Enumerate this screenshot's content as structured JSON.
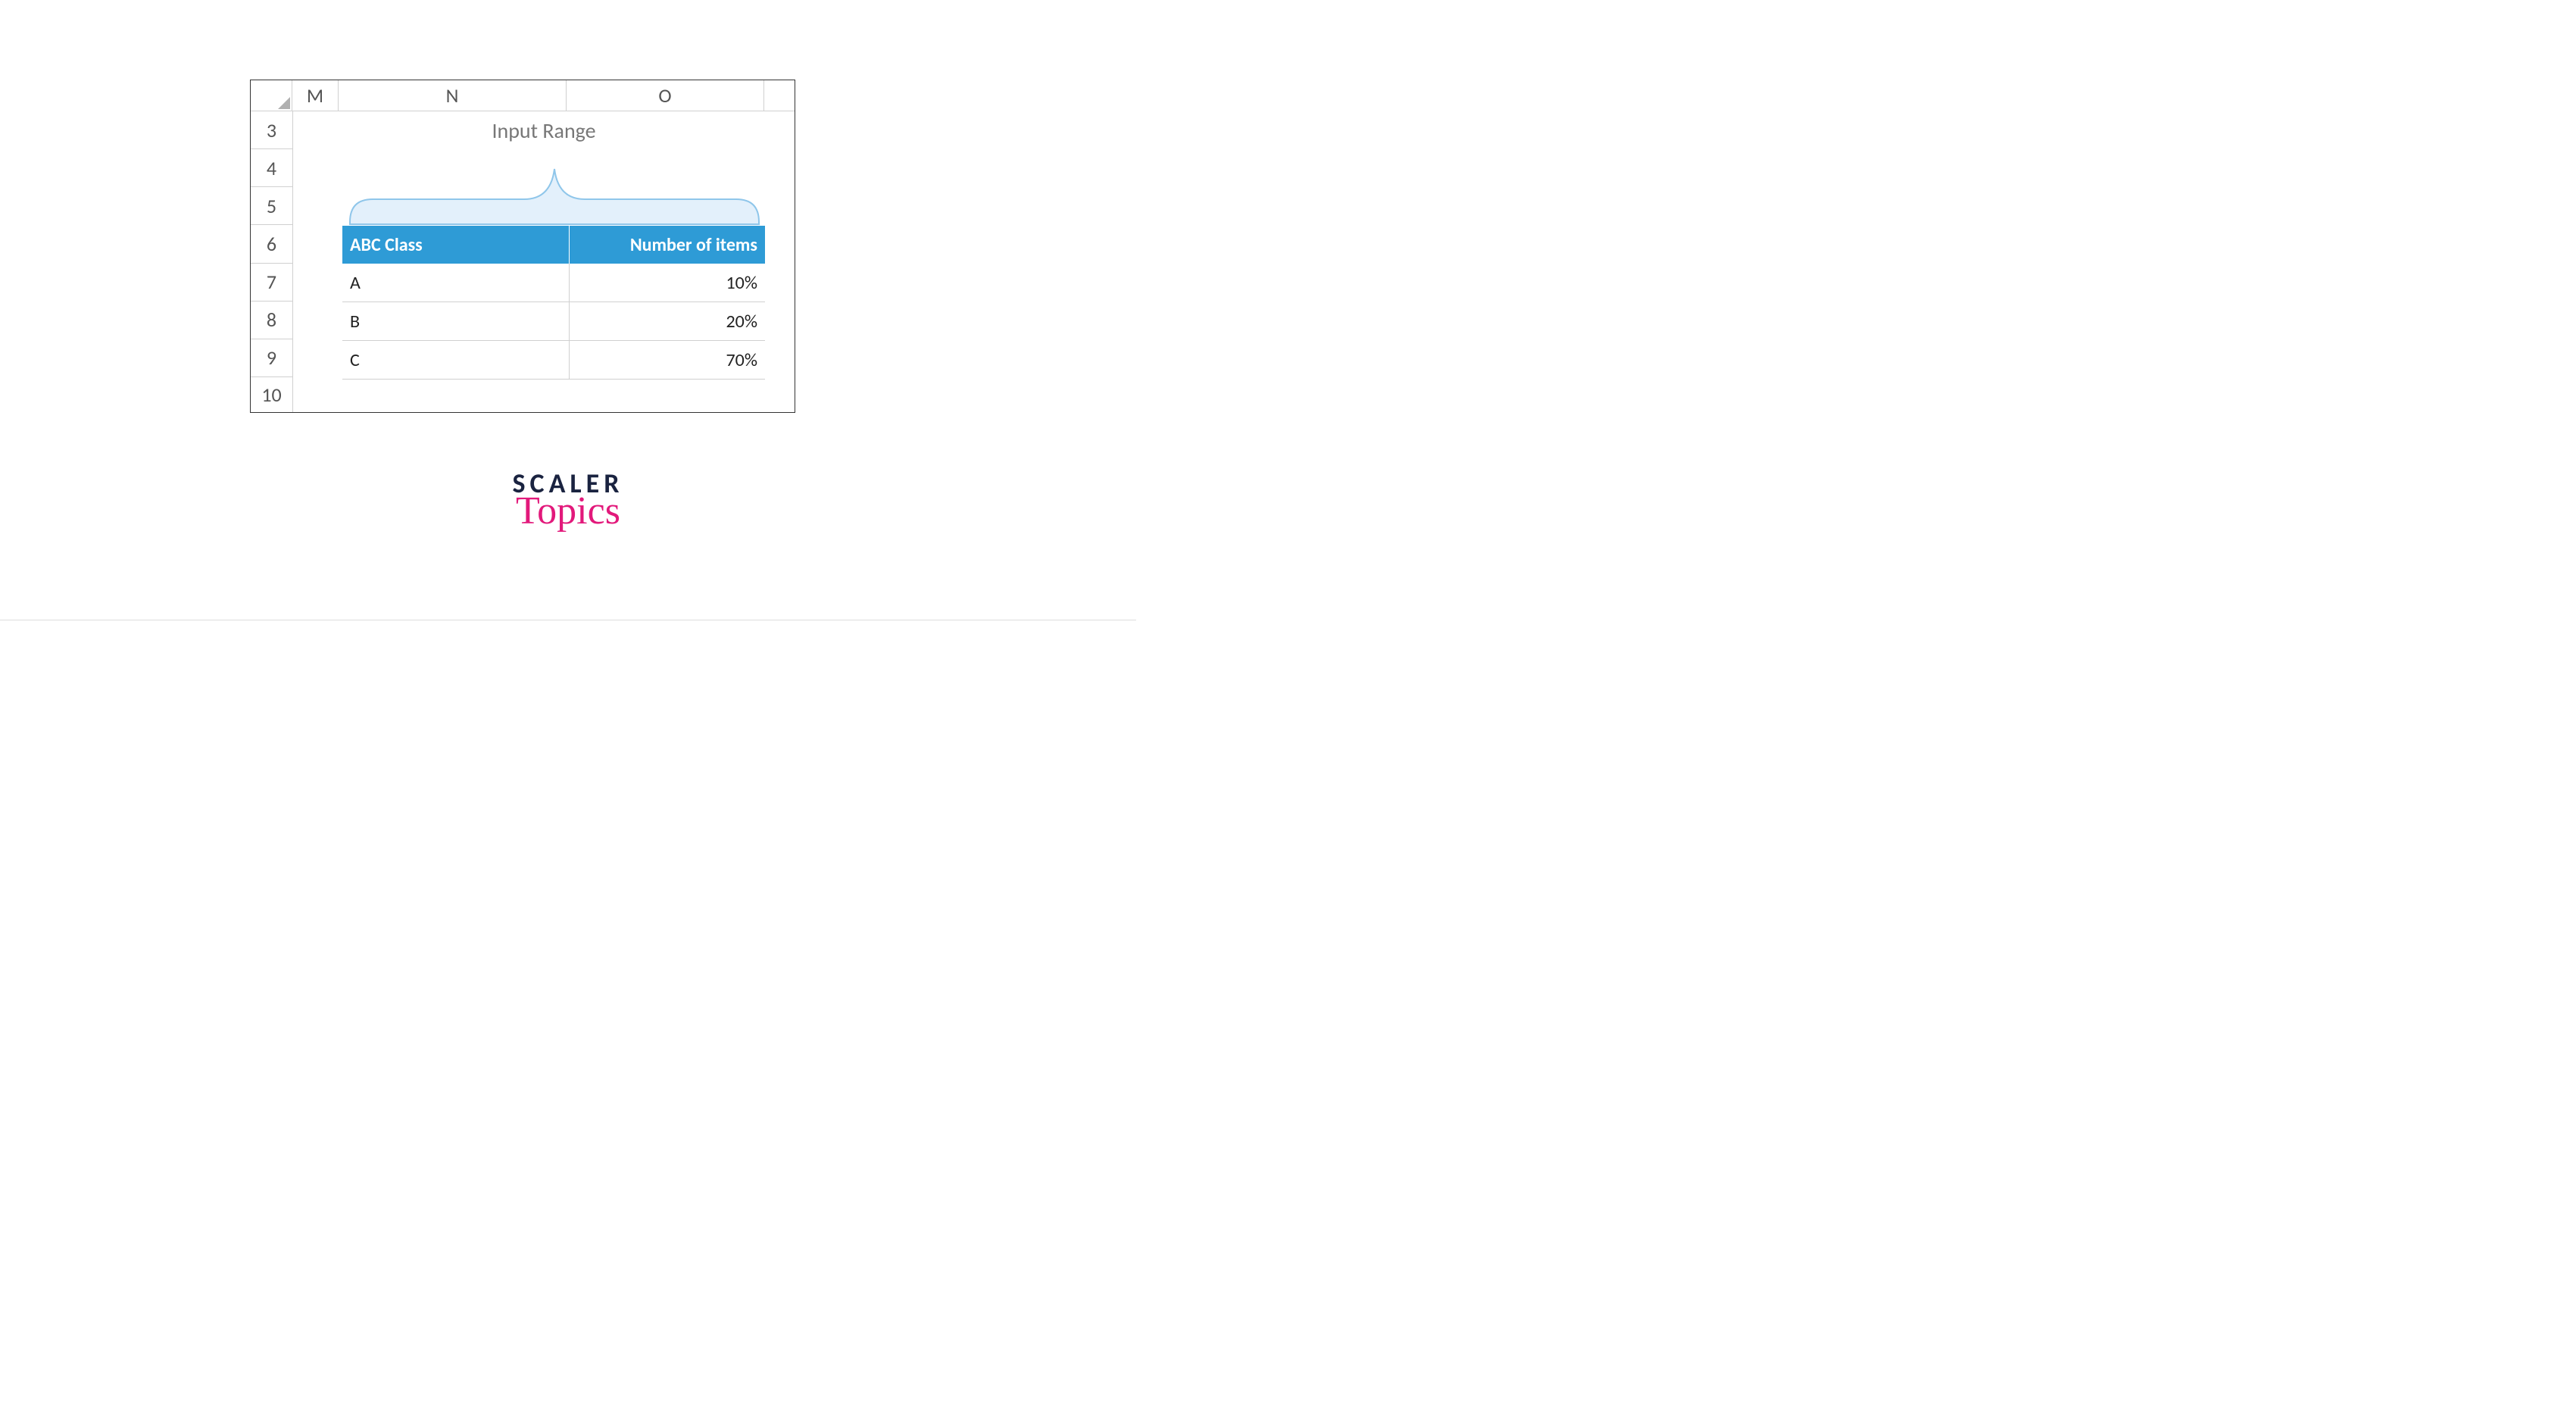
{
  "columns": {
    "M": "M",
    "N": "N",
    "O": "O"
  },
  "rows": [
    "3",
    "4",
    "5",
    "6",
    "7",
    "8",
    "9"
  ],
  "partial_row": "10",
  "callout": "Input Range",
  "table": {
    "headers": {
      "class": "ABC Class",
      "items": "Number of items"
    },
    "rows": [
      {
        "class": "A",
        "items": "10%"
      },
      {
        "class": "B",
        "items": "20%"
      },
      {
        "class": "C",
        "items": "70%"
      }
    ]
  },
  "brand": {
    "top": "SCALER",
    "bottom": "Topics"
  },
  "chart_data": {
    "type": "table",
    "title": "Input Range",
    "columns": [
      "ABC Class",
      "Number of items"
    ],
    "rows": [
      [
        "A",
        "10%"
      ],
      [
        "B",
        "20%"
      ],
      [
        "C",
        "70%"
      ]
    ]
  }
}
